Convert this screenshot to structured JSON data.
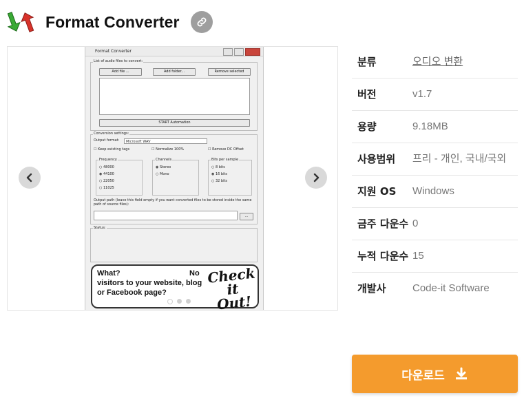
{
  "header": {
    "title": "Format Converter",
    "link_icon": "link-icon"
  },
  "gallery": {
    "prev_icon": "chevron-left-icon",
    "next_icon": "chevron-right-icon",
    "slide_count": 3,
    "active_slide": 1,
    "screenshot": {
      "window_title": "Format Converter",
      "list_label": "List of audio files to convert:",
      "add_file": "Add file ...",
      "add_folder": "Add folder...",
      "remove_selected": "Remove selected",
      "start_automation": "START Automation",
      "conversion_settings": "Conversion settings:",
      "output_format_label": "Output format:",
      "output_format_value": "Microsoft WAV",
      "keep_tags": "Keep existing tags",
      "normalize": "Normalize 100%",
      "remove_dc": "Remove DC Offset",
      "frequency_label": "Frequency",
      "frequencies": [
        "48000",
        "44100",
        "22050",
        "11025"
      ],
      "channels_label": "Channels",
      "channels": [
        "Stereo",
        "Mono"
      ],
      "bits_label": "Bits per sample",
      "bits": [
        "8 bits",
        "16 bits",
        "32 bits"
      ],
      "output_path_label": "Output path (leave this field empty if you want converted files to be stored inside the same path of source files):",
      "browse": "...",
      "status_label": "Status:",
      "promo_line1": "What?",
      "promo_line1b": "No",
      "promo_line2": "visitors to your website, blog",
      "promo_line3": "or Facebook page?",
      "promo_check1": "Check it",
      "promo_check2": "Out!"
    }
  },
  "info": {
    "category_label": "분류",
    "category_value": "오디오 변환",
    "version_label": "버전",
    "version_value": "v1.7",
    "size_label": "용량",
    "size_value": "9.18MB",
    "license_label": "사용범위",
    "license_value": "프리 - 개인, 국내/국외",
    "os_label": "지원 OS",
    "os_value": "Windows",
    "weekly_label": "금주 다운수",
    "weekly_value": "0",
    "total_label": "누적 다운수",
    "total_value": "15",
    "dev_label": "개발사",
    "dev_value": "Code-it Software"
  },
  "download": {
    "label": "다운로드",
    "icon": "download-icon"
  },
  "colors": {
    "accent": "#f49b2d",
    "link_btn": "#9e9e9e",
    "green_arrow": "#3aaa35",
    "red_arrow": "#d8322a"
  }
}
